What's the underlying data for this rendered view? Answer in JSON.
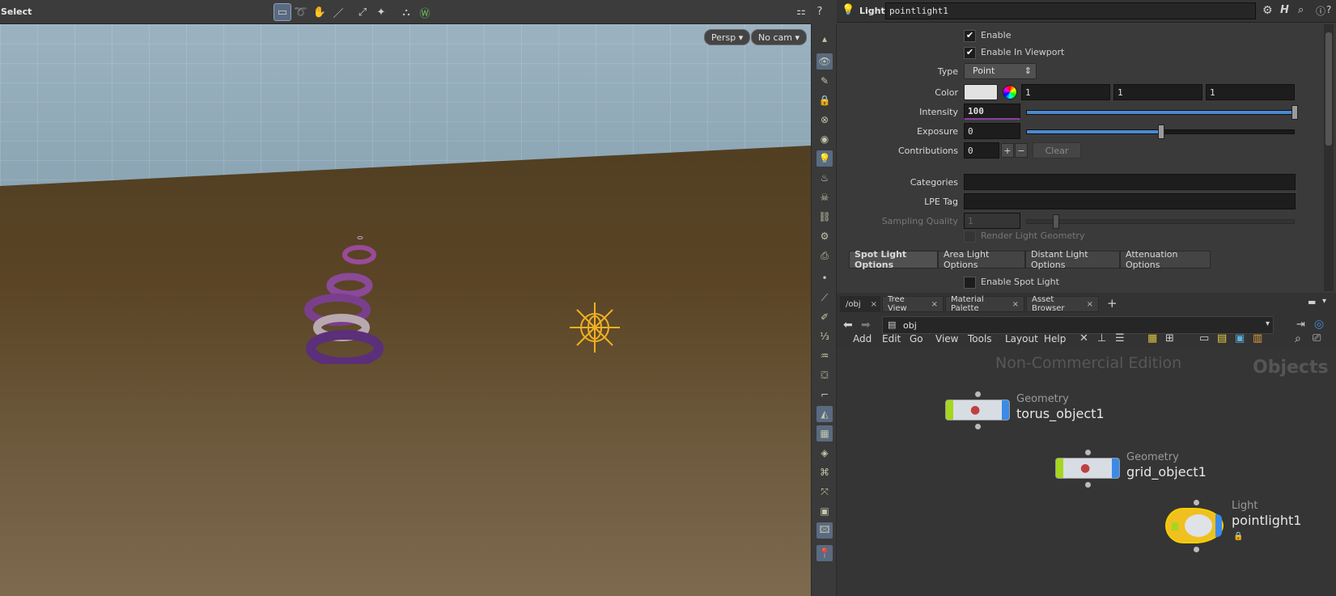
{
  "viewport": {
    "mode_label": "Select",
    "persp_label": "Persp",
    "camera_label": "No cam"
  },
  "param_pane": {
    "node_type": "Light",
    "node_name": "pointlight1",
    "enable_label": "Enable",
    "enable_viewport_label": "Enable In Viewport",
    "type_label": "Type",
    "type_value": "Point",
    "color_label": "Color",
    "color_values": [
      "1",
      "1",
      "1"
    ],
    "intensity_label": "Intensity",
    "intensity_value": "100",
    "intensity_fraction": 1.0,
    "exposure_label": "Exposure",
    "exposure_value": "0",
    "exposure_fraction": 0.5,
    "contributions_label": "Contributions",
    "contributions_value": "0",
    "clear_label": "Clear",
    "categories_label": "Categories",
    "lpe_tag_label": "LPE Tag",
    "sampling_quality_label": "Sampling Quality",
    "sampling_quality_value": "1",
    "render_light_geometry_label": "Render Light Geometry",
    "tabs": [
      "Spot Light Options",
      "Area Light Options",
      "Distant Light Options",
      "Attenuation Options"
    ],
    "enable_spot_label": "Enable Spot Light"
  },
  "network_pane": {
    "tabs": [
      "/obj",
      "Tree View",
      "Material Palette",
      "Asset Browser"
    ],
    "path": "obj",
    "menu": [
      "Add",
      "Edit",
      "Go",
      "View",
      "Tools",
      "Layout",
      "Help"
    ],
    "watermark": "Non-Commercial Edition",
    "context_label": "Objects",
    "nodes": [
      {
        "type": "Geometry",
        "name": "torus_object1"
      },
      {
        "type": "Geometry",
        "name": "grid_object1"
      },
      {
        "type": "Light",
        "name": "pointlight1"
      }
    ]
  },
  "colors": {
    "accent_blue": "#4a8ad0",
    "light_node_yellow": "#f0c020",
    "geo_flag_green": "#a6d61e",
    "geo_flag_blue": "#3a8be8"
  }
}
